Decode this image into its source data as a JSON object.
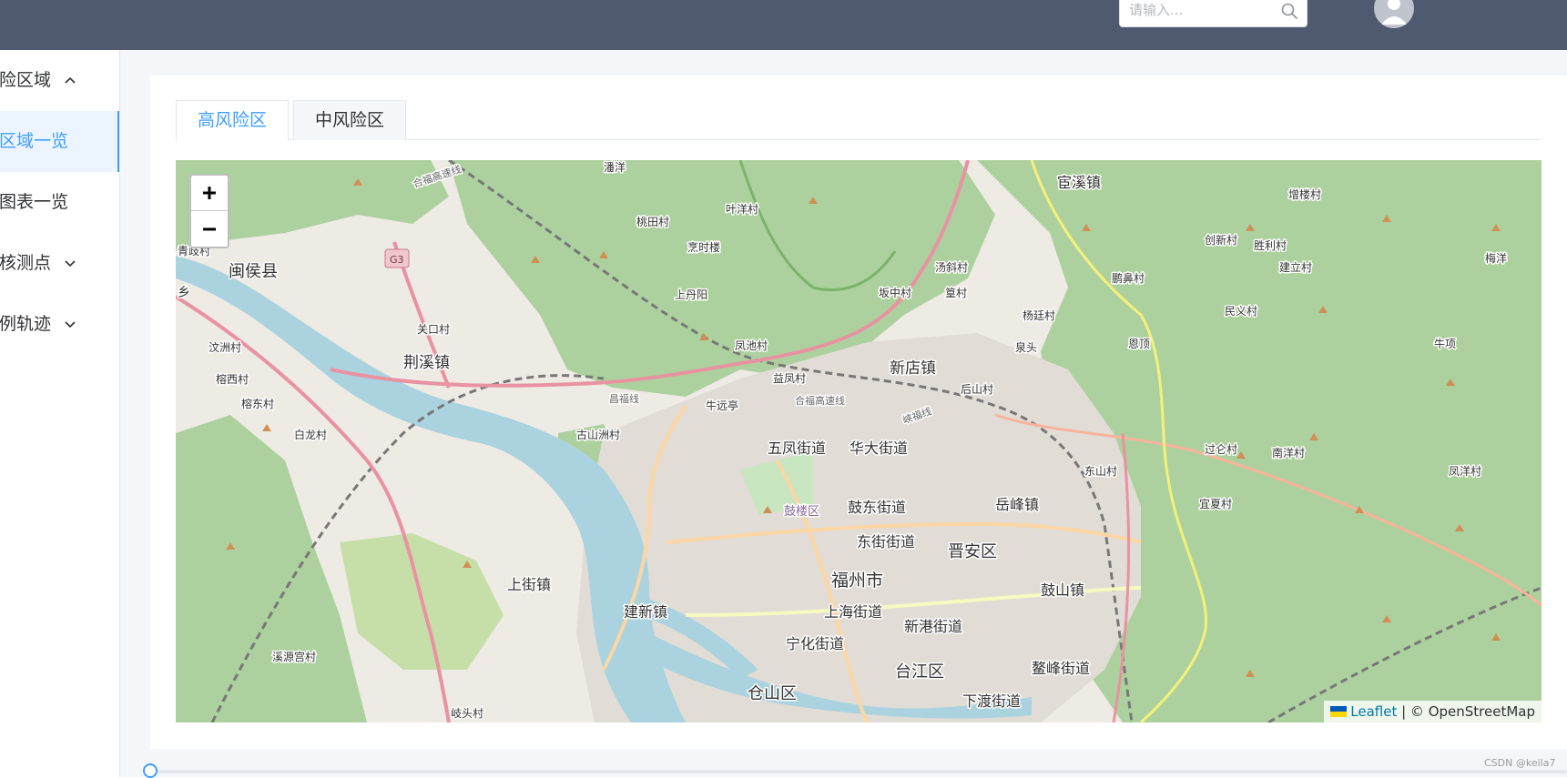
{
  "header": {
    "search": {
      "placeholder": "请输入...",
      "value": ""
    }
  },
  "sidebar": {
    "items": [
      {
        "label": "险区域",
        "chevron": "up"
      },
      {
        "label": "区域一览",
        "active": true
      },
      {
        "label": "图表一览"
      },
      {
        "label": "核测点",
        "chevron": "down"
      },
      {
        "label": "例轨迹",
        "chevron": "down"
      }
    ]
  },
  "tabs": [
    {
      "label": "高风险区",
      "active": true
    },
    {
      "label": "中风险区",
      "active": false
    }
  ],
  "map": {
    "zoom_in": "+",
    "zoom_out": "−",
    "attribution": {
      "leaflet": "Leaflet",
      "rest": " | © OpenStreetMap"
    },
    "labels": {
      "minhou": "闽侯县",
      "jingxi": "荆溪镇",
      "huanxi": "宦溪镇",
      "xindian": "新店镇",
      "wufeng": "五凤街道",
      "huada": "华大街道",
      "gudong": "鼓东街道",
      "dongjie": "东街街道",
      "jinan": "晋安区",
      "yuefeng": "岳峰镇",
      "fuzhou": "福州市",
      "shanghai": "上海街道",
      "xingang": "新港街道",
      "gushan_town": "鼓山镇",
      "shangjie": "上街镇",
      "jianxin": "建新镇",
      "ninghua": "宁化街道",
      "taijiang": "台江区",
      "aofeng": "鳌峰街道",
      "cangshan": "仓山区",
      "xiadu": "下渡街道",
      "gulou": "鼓楼区",
      "guxi": "古山洲村",
      "niuyuan": "牛远亭",
      "baishan": "白龙村",
      "wenzhou": "汶洲村",
      "rongxi": "榕西村",
      "rongdong": "榕东村",
      "guankou": "关口村",
      "fengchi": "凤池村",
      "shangdan": "上丹阳",
      "taotian": "桃田村",
      "yeyang": "叶洋村",
      "pengshi": "烹时楼",
      "panyang": "潘洋",
      "tangdou": "汤斜村",
      "banzhong": "坂中村",
      "miao": "篁村",
      "yangting": "杨廷村",
      "quantou": "泉头",
      "houshan": "后山村",
      "yifeng": "益凤村",
      "pengbi": "鹏鼻村",
      "chuangxin": "创新村",
      "shengli": "胜利村",
      "zenglou": "增楼村",
      "jianli": "建立村",
      "minyi": "民义村",
      "meiyang": "梅洋",
      "niuxiang": "牛项",
      "enting": "恩顶",
      "guolun": "过仑村",
      "nanyang": "南洋村",
      "yixia": "宜夏村",
      "dongshan": "东山村",
      "fengyang": "凤洋村",
      "xiyuan": "溪源宫村",
      "qitou": "岐头村",
      "qingqi": "青歧村",
      "xiang": "乡",
      "g3": "G3",
      "changfu": "昌福线",
      "hefu": "合福高速线",
      "hefu2": "合福高速线",
      "yinfu": "峡福线"
    }
  },
  "footer": {
    "watermark": "CSDN @keila7"
  }
}
